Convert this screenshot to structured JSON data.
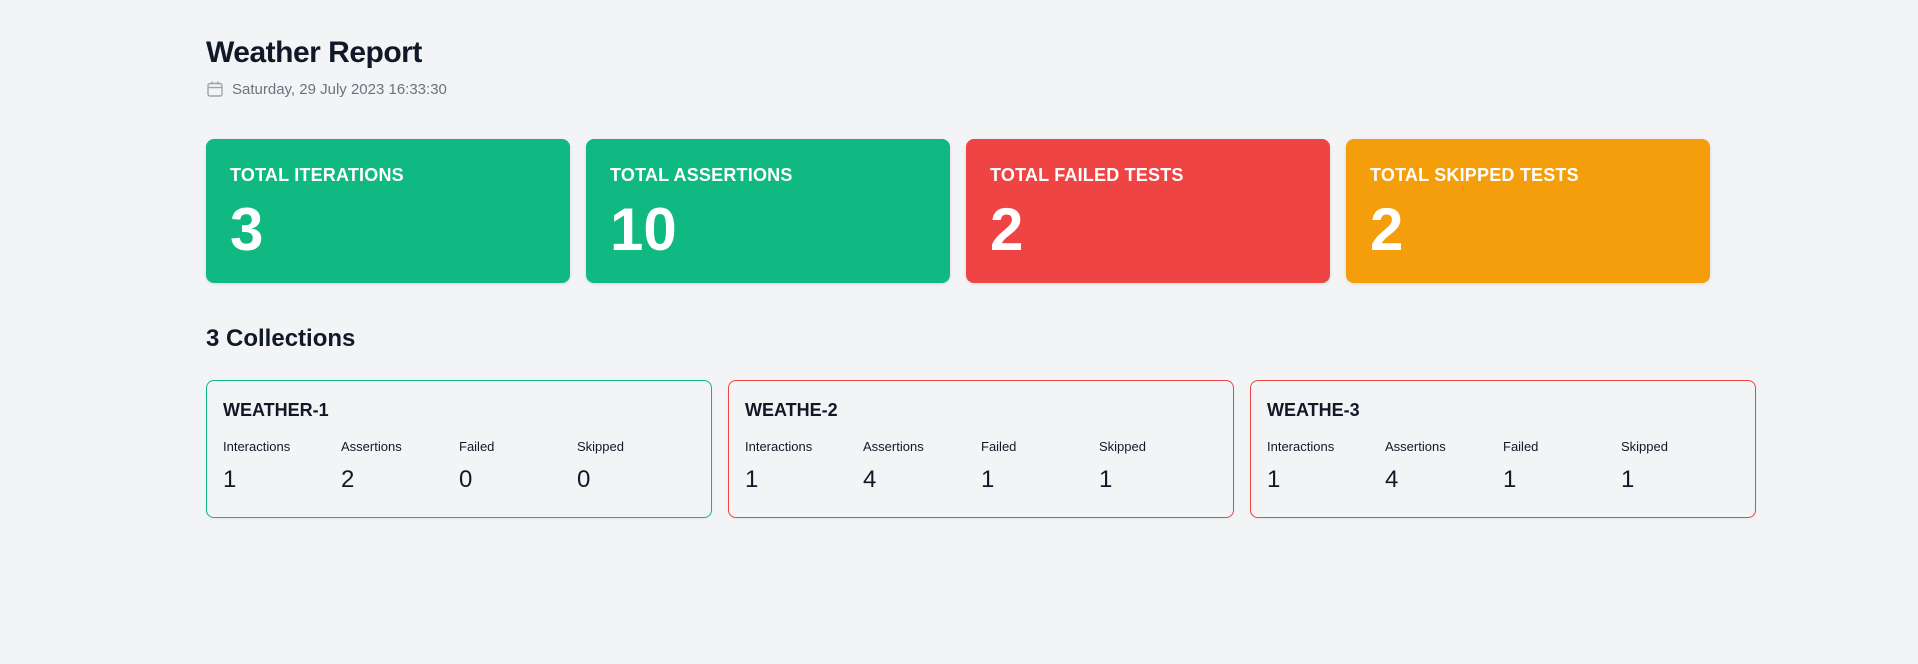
{
  "header": {
    "title": "Weather Report",
    "date": "Saturday, 29 July 2023 16:33:30",
    "date_icon": "calendar-icon"
  },
  "colors": {
    "success": "#10b981",
    "danger": "#ef4444",
    "warning": "#f59e0b",
    "background": "#f3f4f6"
  },
  "stats": [
    {
      "label": "TOTAL ITERATIONS",
      "value": "3",
      "color": "#10b981"
    },
    {
      "label": "TOTAL ASSERTIONS",
      "value": "10",
      "color": "#10b981"
    },
    {
      "label": "TOTAL FAILED TESTS",
      "value": "2",
      "color": "#ef4444"
    },
    {
      "label": "TOTAL SKIPPED TESTS",
      "value": "2",
      "color": "#f59e0b"
    }
  ],
  "collections_section": {
    "title": "3 Collections"
  },
  "collections": [
    {
      "name": "WEATHER-1",
      "status": "passed",
      "metrics": [
        {
          "label": "Interactions",
          "value": "1"
        },
        {
          "label": "Assertions",
          "value": "2"
        },
        {
          "label": "Failed",
          "value": "0"
        },
        {
          "label": "Skipped",
          "value": "0"
        }
      ]
    },
    {
      "name": "WEATHE-2",
      "status": "failed",
      "metrics": [
        {
          "label": "Interactions",
          "value": "1"
        },
        {
          "label": "Assertions",
          "value": "4"
        },
        {
          "label": "Failed",
          "value": "1"
        },
        {
          "label": "Skipped",
          "value": "1"
        }
      ]
    },
    {
      "name": "WEATHE-3",
      "status": "failed",
      "metrics": [
        {
          "label": "Interactions",
          "value": "1"
        },
        {
          "label": "Assertions",
          "value": "4"
        },
        {
          "label": "Failed",
          "value": "1"
        },
        {
          "label": "Skipped",
          "value": "1"
        }
      ]
    }
  ]
}
